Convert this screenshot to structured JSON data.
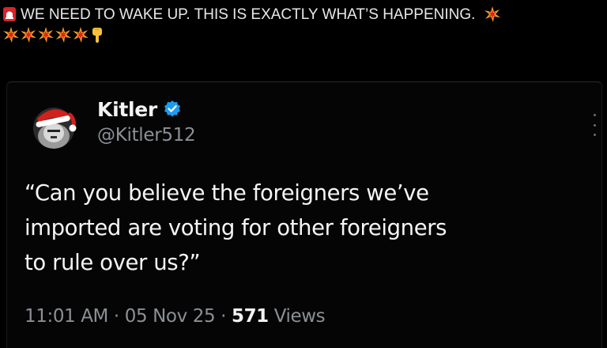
{
  "caption": {
    "line1": "WE NEED TO WAKE UP. THIS IS EXACTLY WHAT’S HAPPENING.",
    "icons": [
      "siren-emoji-icon",
      "collision-emoji-icon",
      "pointing-down-emoji-icon"
    ]
  },
  "tweet": {
    "author_name": "Kitler",
    "author_handle": "@Kitler512",
    "text_lines": [
      "“Can you believe the foreigners we’ve",
      "imported are voting for other foreigners",
      "to rule over us?”"
    ],
    "time": "11:01 AM",
    "separator": "·",
    "date": "05 Nov 25",
    "views_count": "571",
    "views_label": "Views"
  },
  "colors": {
    "background": "#000000",
    "text_primary": "#f5f5f5",
    "text_secondary": "#8b9096",
    "verified_blue": "#1d9bf0"
  }
}
